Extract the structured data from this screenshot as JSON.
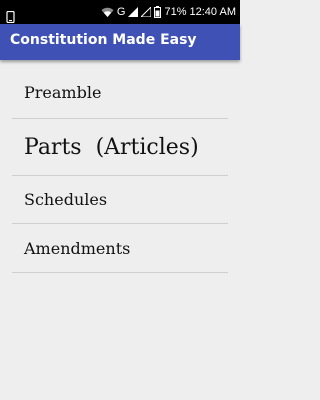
{
  "status_bar": {
    "network_label": "G",
    "battery_percent": "71%",
    "time": "12:40 AM",
    "icons": [
      "phone-notification-icon",
      "wifi-icon",
      "signal-icon",
      "signal-empty-icon",
      "battery-icon"
    ]
  },
  "app_bar": {
    "title": "Constitution Made Easy",
    "color": "#3f51b5"
  },
  "menu": {
    "items": [
      {
        "label": "Preamble"
      },
      {
        "label": "Parts  (Articles)"
      },
      {
        "label": "Schedules"
      },
      {
        "label": "Amendments"
      }
    ]
  }
}
